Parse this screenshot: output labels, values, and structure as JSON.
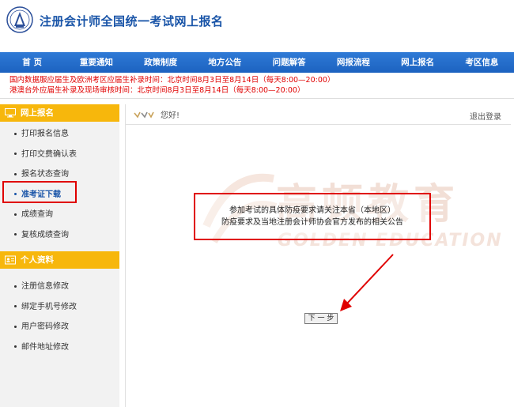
{
  "header": {
    "title": "注册会计师全国统一考试网上报名"
  },
  "nav": {
    "items": [
      {
        "label": "首 页"
      },
      {
        "label": "重要通知"
      },
      {
        "label": "政策制度"
      },
      {
        "label": "地方公告"
      },
      {
        "label": "问题解答"
      },
      {
        "label": "网报流程"
      },
      {
        "label": "网上报名"
      },
      {
        "label": "考区信息"
      }
    ]
  },
  "notices": [
    "国内数据服应届生及欧洲考区应届生补录时间：北京时间8月3日至8月14日（每天8:00—20:00）",
    "港澳台外应届生补录及现场审核时间：北京时间8月3日至8月14日（每天8:00—20:00）"
  ],
  "sidebar": {
    "section1": {
      "title": "网上报名",
      "items": [
        {
          "label": "打印报名信息"
        },
        {
          "label": "打印交费确认表"
        },
        {
          "label": "报名状态查询"
        },
        {
          "label": "准考证下载"
        },
        {
          "label": "成绩查询"
        },
        {
          "label": "复核成绩查询"
        }
      ]
    },
    "section2": {
      "title": "个人资料",
      "items": [
        {
          "label": "注册信息修改"
        },
        {
          "label": "绑定手机号修改"
        },
        {
          "label": "用户密码修改"
        },
        {
          "label": "邮件地址修改"
        }
      ]
    }
  },
  "main": {
    "greeting": "您好!",
    "logout": "退出登录",
    "watermark_cn": "高顿教育",
    "watermark_en": "GOLDEN EDUCATION",
    "notice_lines": [
      "参加考试的具体防疫要求请关注本省（本地区）",
      "防疫要求及当地注册会计师协会官方发布的相关公告"
    ],
    "next_button": "下 一 步"
  },
  "colors": {
    "brand_blue": "#1a55a8",
    "nav_blue": "#2370cc",
    "sidebar_header": "#f7b70c",
    "highlight_red": "#e00000",
    "notice_red": "#e00000"
  },
  "icons": {
    "logo": "cicpa-emblem-icon",
    "section1": "monitor-icon",
    "section2": "id-card-icon",
    "greeting": "wave-decoration-icon",
    "annotation": "red-arrow-icon"
  }
}
